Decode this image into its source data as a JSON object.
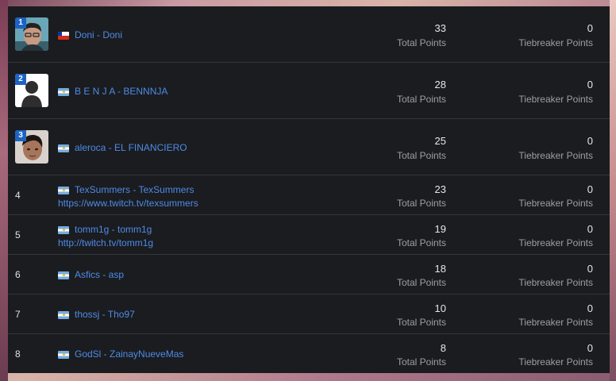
{
  "total_label": "Total Points",
  "tiebreaker_label": "Tiebreaker Points",
  "rows": [
    {
      "rank": "1",
      "flag": "cl",
      "player": "Doni - Doni",
      "link": "",
      "total": "33",
      "tiebreaker": "0"
    },
    {
      "rank": "2",
      "flag": "ar",
      "player": "B E N J A - BENNNJA",
      "link": "",
      "total": "28",
      "tiebreaker": "0"
    },
    {
      "rank": "3",
      "flag": "ar",
      "player": "aleroca - EL FINANCIERO",
      "link": "",
      "total": "25",
      "tiebreaker": "0"
    },
    {
      "rank": "4",
      "flag": "ar",
      "player": "TexSummers - TexSummers",
      "link": "https://www.twitch.tv/texsummers",
      "total": "23",
      "tiebreaker": "0"
    },
    {
      "rank": "5",
      "flag": "ar",
      "player": "tomm1g - tomm1g",
      "link": "http://twitch.tv/tomm1g",
      "total": "19",
      "tiebreaker": "0"
    },
    {
      "rank": "6",
      "flag": "ar",
      "player": "Asfics - asp",
      "link": "",
      "total": "18",
      "tiebreaker": "0"
    },
    {
      "rank": "7",
      "flag": "ar",
      "player": "thossj - Tho97",
      "link": "",
      "total": "10",
      "tiebreaker": "0"
    },
    {
      "rank": "8",
      "flag": "ar",
      "player": "GodSl - ZainayNueveMas",
      "link": "",
      "total": "8",
      "tiebreaker": "0"
    }
  ],
  "colors": {
    "link": "#4d8be8",
    "badge": "#1e63c4",
    "panel": "#1b1c1f"
  }
}
